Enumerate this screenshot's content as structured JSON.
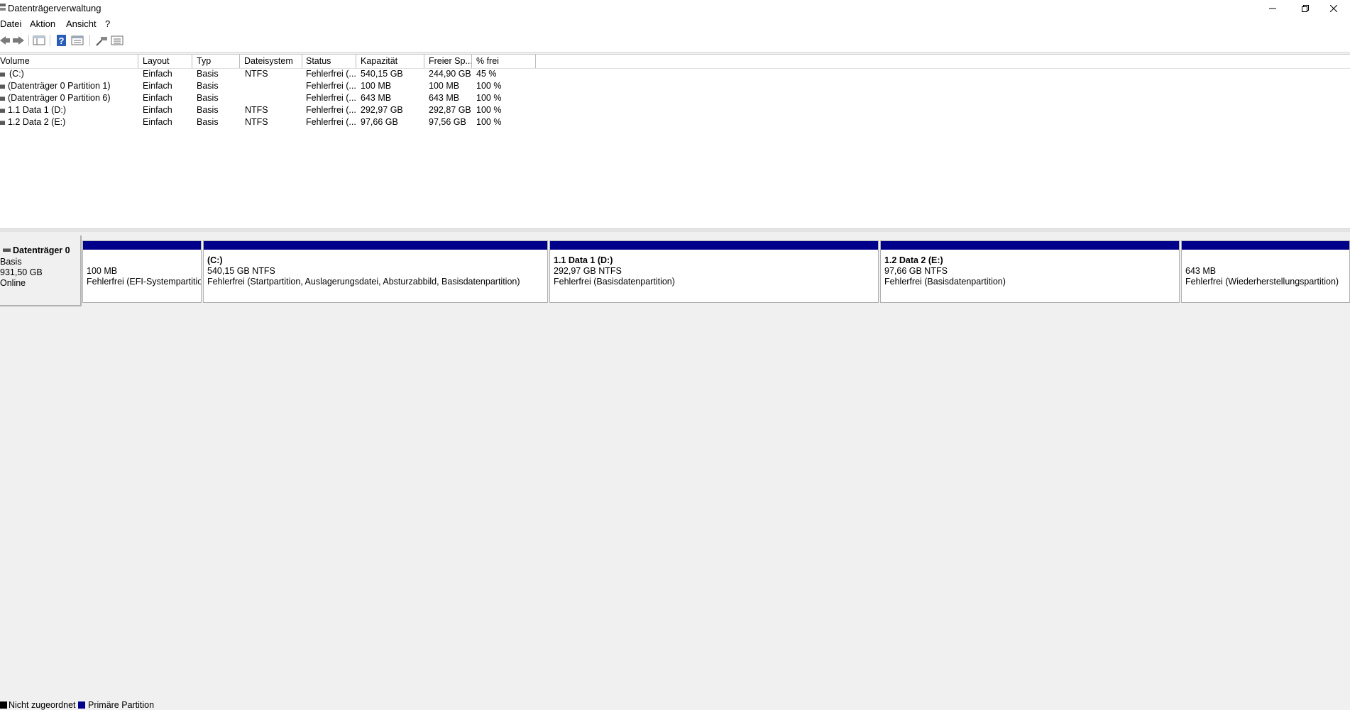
{
  "window": {
    "title": "Datenträgerverwaltung",
    "icon": "disk-management-icon"
  },
  "menu": [
    "Datei",
    "Aktion",
    "Ansicht",
    "?"
  ],
  "toolbar": {
    "icons": [
      "back-arrow-icon",
      "forward-arrow-icon",
      "console-tree-icon",
      "help-icon",
      "properties-icon",
      "rescan-icon",
      "view-list-icon"
    ]
  },
  "volume_list": {
    "columns": [
      "Volume",
      "Layout",
      "Typ",
      "Dateisystem",
      "Status",
      "Kapazität",
      "Freier Sp...",
      "% frei"
    ],
    "rows": [
      {
        "volume": "(C:)",
        "layout": "Einfach",
        "typ": "Basis",
        "fs": "NTFS",
        "status": "Fehlerfrei (...",
        "cap": "540,15 GB",
        "free": "244,90 GB",
        "pct": "45 %"
      },
      {
        "volume": "(Datenträger 0 Partition 1)",
        "layout": "Einfach",
        "typ": "Basis",
        "fs": "",
        "status": "Fehlerfrei (...",
        "cap": "100 MB",
        "free": "100 MB",
        "pct": "100 %"
      },
      {
        "volume": "(Datenträger 0 Partition 6)",
        "layout": "Einfach",
        "typ": "Basis",
        "fs": "",
        "status": "Fehlerfrei (...",
        "cap": "643 MB",
        "free": "643 MB",
        "pct": "100 %"
      },
      {
        "volume": "1.1 Data 1 (D:)",
        "layout": "Einfach",
        "typ": "Basis",
        "fs": "NTFS",
        "status": "Fehlerfrei (...",
        "cap": "292,97 GB",
        "free": "292,87 GB",
        "pct": "100 %"
      },
      {
        "volume": "1.2 Data 2 (E:)",
        "layout": "Einfach",
        "typ": "Basis",
        "fs": "NTFS",
        "status": "Fehlerfrei (...",
        "cap": "97,66 GB",
        "free": "97,56 GB",
        "pct": "100 %"
      }
    ]
  },
  "disk": {
    "name": "Datenträger 0",
    "type": "Basis",
    "size": "931,50 GB",
    "state": "Online",
    "partitions": [
      {
        "name": "",
        "size": "100 MB",
        "status": "Fehlerfrei (EFI-Systempartition)"
      },
      {
        "name": "(C:)",
        "size": "540,15 GB NTFS",
        "status": "Fehlerfrei (Startpartition, Auslagerungsdatei, Absturzabbild, Basisdatenpartition)"
      },
      {
        "name": "1.1 Data 1  (D:)",
        "size": "292,97 GB NTFS",
        "status": "Fehlerfrei (Basisdatenpartition)"
      },
      {
        "name": "1.2 Data 2  (E:)",
        "size": "97,66 GB NTFS",
        "status": "Fehlerfrei (Basisdatenpartition)"
      },
      {
        "name": "",
        "size": "643 MB",
        "status": "Fehlerfrei (Wiederherstellungspartition)"
      }
    ]
  },
  "legend": [
    {
      "label": "Nicht zugeordnet",
      "color": "#000000"
    },
    {
      "label": "Primäre Partition",
      "color": "#00008b"
    }
  ],
  "colors": {
    "partition_bar": "#00008b",
    "background": "#f0f0f0"
  }
}
